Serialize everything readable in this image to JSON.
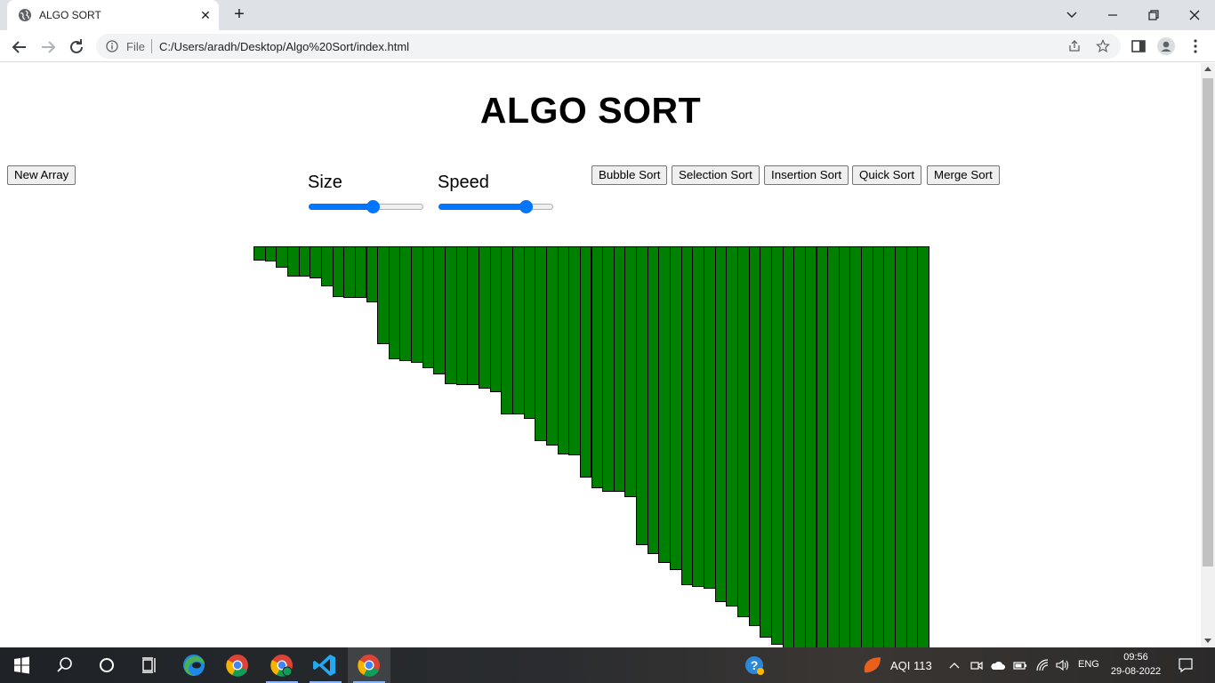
{
  "browser": {
    "tab_title": "ALGO SORT",
    "new_tab_symbol": "+",
    "tab_close_symbol": "✕",
    "file_label": "File",
    "url": "C:/Users/aradh/Desktop/Algo%20Sort/index.html"
  },
  "page": {
    "title": "ALGO SORT",
    "new_array_label": "New Array",
    "size_label": "Size",
    "speed_label": "Speed",
    "size_value_fraction": 0.57,
    "speed_value_fraction": 0.8,
    "sort_buttons": [
      "Bubble Sort",
      "Selection Sort",
      "Insertion Sort",
      "Quick Sort",
      "Merge Sort"
    ]
  },
  "colors": {
    "bar": "#008000",
    "slider_accent": "#0075ff"
  },
  "array_values": [
    16,
    17,
    24,
    34,
    34,
    36,
    45,
    57,
    58,
    58,
    63,
    110,
    127,
    129,
    131,
    137,
    144,
    155,
    156,
    156,
    160,
    164,
    189,
    189,
    194,
    219,
    224,
    234,
    235,
    260,
    272,
    276,
    276,
    282,
    336,
    346,
    356,
    364,
    381,
    383,
    385,
    400,
    405,
    417,
    427,
    440,
    448,
    452,
    458,
    458,
    458,
    458,
    458,
    458,
    458,
    458,
    458,
    458,
    458,
    458
  ],
  "taskbar": {
    "aqi_label": "AQI 113",
    "lang": "ENG",
    "time": "09:56",
    "date": "29-08-2022"
  },
  "icons": [
    "globe-icon",
    "close-icon",
    "plus-icon",
    "chevron-down-icon",
    "minimize-icon",
    "restore-icon",
    "close-window-icon",
    "back-arrow-icon",
    "forward-arrow-icon",
    "reload-icon",
    "info-icon",
    "share-icon",
    "star-icon",
    "side-panel-icon",
    "profile-icon",
    "kebab-menu-icon",
    "windows-start-icon",
    "search-icon",
    "cortana-icon",
    "task-view-icon",
    "edge-icon",
    "chrome-icon",
    "vscode-icon",
    "help-icon",
    "weather-icon"
  ]
}
